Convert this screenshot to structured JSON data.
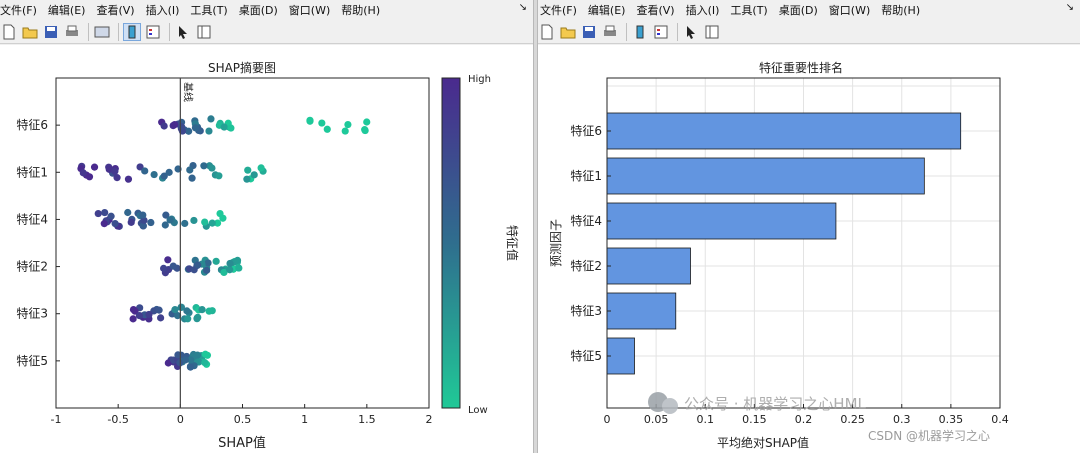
{
  "menu": [
    "文件(F)",
    "编辑(E)",
    "查看(V)",
    "插入(I)",
    "工具(T)",
    "桌面(D)",
    "窗口(W)",
    "帮助(H)"
  ],
  "pin_glyph": "↘",
  "colors": {
    "low": "#1ec99a",
    "high": "#4b2a8e",
    "bar": "#6295e0",
    "bar_edge": "#1a1a1a"
  },
  "chart_data": [
    {
      "type": "scatter",
      "title": "SHAP摘要图",
      "xlabel": "SHAP值",
      "ylabel": "",
      "xlim": [
        -1,
        2
      ],
      "xticks": [
        "-1",
        "-0.5",
        "0",
        "0.5",
        "1",
        "1.5",
        "2"
      ],
      "categories": [
        "特征6",
        "特征1",
        "特征4",
        "特征2",
        "特征3",
        "特征5"
      ],
      "baseline_label": "基线",
      "colorbar": {
        "title": "特征值",
        "high_label": "High",
        "low_label": "Low"
      },
      "grid": false
    },
    {
      "type": "bar",
      "orientation": "horizontal",
      "title": "特征重要性排名",
      "xlabel": "平均绝对SHAP值",
      "ylabel": "预测因子",
      "categories": [
        "特征6",
        "特征1",
        "特征4",
        "特征2",
        "特征3",
        "特征5"
      ],
      "values": [
        0.36,
        0.323,
        0.233,
        0.085,
        0.07,
        0.028
      ],
      "xlim": [
        0,
        0.4
      ],
      "xticks": [
        "0",
        "0.05",
        "0.1",
        "0.15",
        "0.2",
        "0.25",
        "0.3",
        "0.35",
        "0.4"
      ],
      "grid": true
    }
  ],
  "watermark": {
    "line1": "公众号 · 机器学习之心HML",
    "line2": "CSDN @机器学习之心"
  }
}
